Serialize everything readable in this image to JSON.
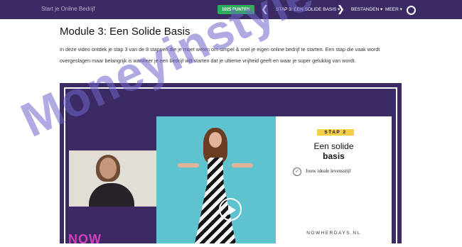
{
  "header": {
    "brand": "Start je Online Bedrijf",
    "points": "1025 PUNTEN",
    "prev_icon": "chevron-left-icon",
    "next_icon": "chevron-right-icon",
    "step": "STAP 3: EEN SOLIDE BASIS ▾",
    "files": "BESTANDEN ▾",
    "more": "MEER ▾",
    "profile_icon": "ring-icon"
  },
  "module": {
    "title": "Module 3: Een Solide Basis",
    "intro": "In deze video ontdek je stap 3 van de 8 stappen die je moet weten om simpel & snel je eigen online bedrijf te starten. Een stap die vaak wordt overgeslagen maar belangrijk is wanneer je een bedrijf wilt starten dat je ultieme vrijheid geeft en waar je super gelukkig van wordt."
  },
  "video": {
    "slide": {
      "badge": "STAP 2",
      "title_line1": "Een solide",
      "title_line2": "basis",
      "checklist_item": "Jouw ideale levensstijl",
      "site": "NOWHERDAYS.NL"
    },
    "corner_text": "NOW",
    "play_icon": "play-icon"
  },
  "watermark": "Moneyinstyle",
  "colors": {
    "topbar": "#3b2a63",
    "points_badge": "#2eac5d",
    "video_bg": "#3b2a63",
    "photo_bg": "#5fc2cf",
    "badge": "#f6cf49"
  }
}
